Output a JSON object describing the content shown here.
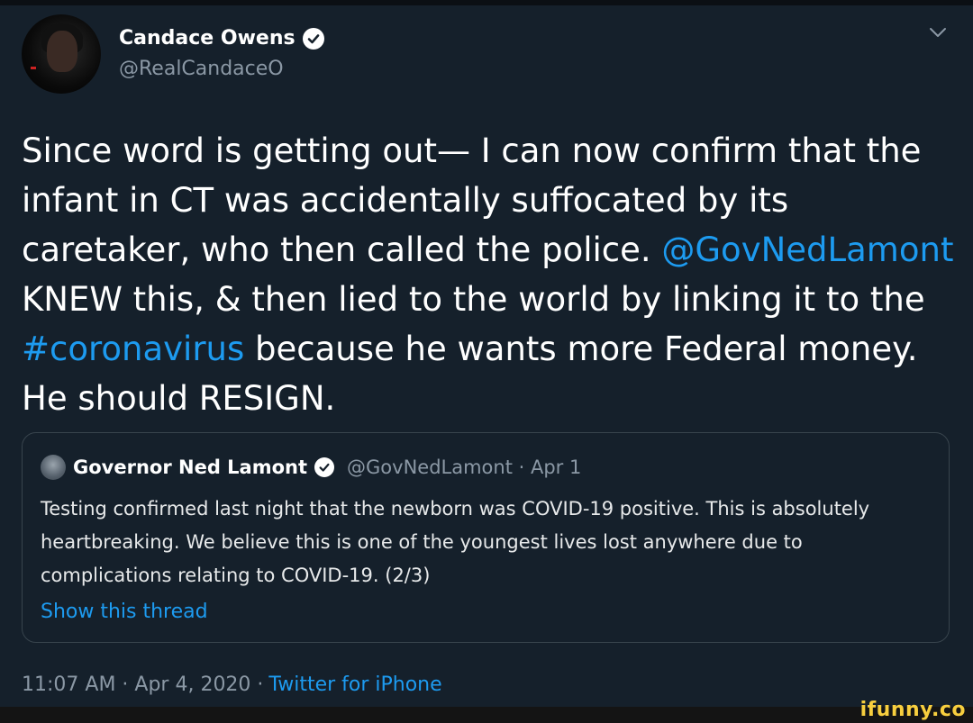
{
  "tweet": {
    "author": {
      "name": "Candace Owens",
      "handle": "@RealCandaceO"
    },
    "text": {
      "part1": "Since word is getting out— I can now confirm that the infant in CT was accidentally suffocated by its caretaker, who then called the police. ",
      "mention": "@GovNedLamont",
      "part2": " KNEW this, & then lied to the world by linking it to the ",
      "hashtag": "#coronavirus",
      "part3": " because he wants more Federal money. He should RESIGN."
    },
    "quoted": {
      "name": "Governor Ned Lamont",
      "handle_date": "@GovNedLamont · Apr 1",
      "text": "Testing confirmed last night that the newborn was COVID-19 positive. This is absolutely heartbreaking. We believe this is one of the youngest lives lost anywhere due to complications relating to COVID-19. (2/3)",
      "show_thread": "Show this thread"
    },
    "meta": {
      "time_date": "11:07 AM · Apr 4, 2020 ·",
      "source": "Twitter for iPhone"
    }
  },
  "watermark": "ifunny.co",
  "colors": {
    "background": "#15202b",
    "link": "#1d9bf0",
    "secondary_text": "#8b98a5",
    "border": "#38444d",
    "watermark": "#f7ce3e"
  },
  "icons": {
    "verified": "verified-badge-icon",
    "more": "chevron-down-icon"
  }
}
